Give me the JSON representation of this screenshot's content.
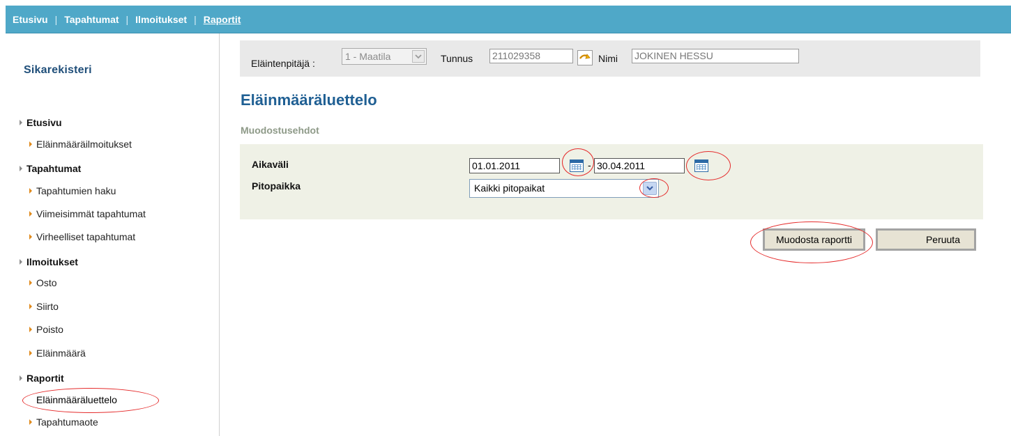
{
  "topnav": {
    "items": [
      {
        "label": "Etusivu"
      },
      {
        "label": "Tapahtumat"
      },
      {
        "label": "Ilmoitukset"
      },
      {
        "label": "Raportit"
      }
    ],
    "active": "Raportit"
  },
  "sidebar": {
    "title": "Sikarekisteri",
    "sections": [
      {
        "label": "Etusivu",
        "items": [
          "Eläinmääräilmoitukset"
        ]
      },
      {
        "label": "Tapahtumat",
        "items": [
          "Tapahtumien haku",
          "Viimeisimmät tapahtumat",
          "Virheelliset tapahtumat"
        ]
      },
      {
        "label": "Ilmoitukset",
        "items": [
          "Osto",
          "Siirto",
          "Poisto",
          "Eläinmäärä"
        ]
      },
      {
        "label": "Raportit",
        "items": [
          "Eläinmääräluettelo",
          "Tapahtumaote"
        ]
      }
    ],
    "current_item": "Eläinmääräluettelo"
  },
  "filterbar": {
    "owner_label": "Eläintenpitäjä :",
    "owner_value": "1 - Maatila",
    "tunnus_label": "Tunnus",
    "tunnus_value": "211029358",
    "nimi_label": "Nimi",
    "nimi_value": "JOKINEN HESSU"
  },
  "page": {
    "title": "Eläinmääräluettelo",
    "section_title": "Muodostusehdot"
  },
  "criteria": {
    "aikavali_label": "Aikaväli",
    "start_date": "01.01.2011",
    "date_separator": "-",
    "end_date": "30.04.2011",
    "pitopaikka_label": "Pitopaikka",
    "pitopaikka_value": "Kaikki pitopaikat"
  },
  "buttons": {
    "submit_label": "Muodosta raportti",
    "cancel_label": "Peruuta"
  },
  "colors": {
    "topnav_bg": "#4fa8c8",
    "title": "#1f5f93",
    "criteria_bg": "#eff1e6",
    "annotation": "#e52b2b"
  },
  "icons": {
    "calendar": "calendar-icon",
    "dropdown": "chevron-down-icon",
    "refresh": "refresh-arrow-icon"
  }
}
